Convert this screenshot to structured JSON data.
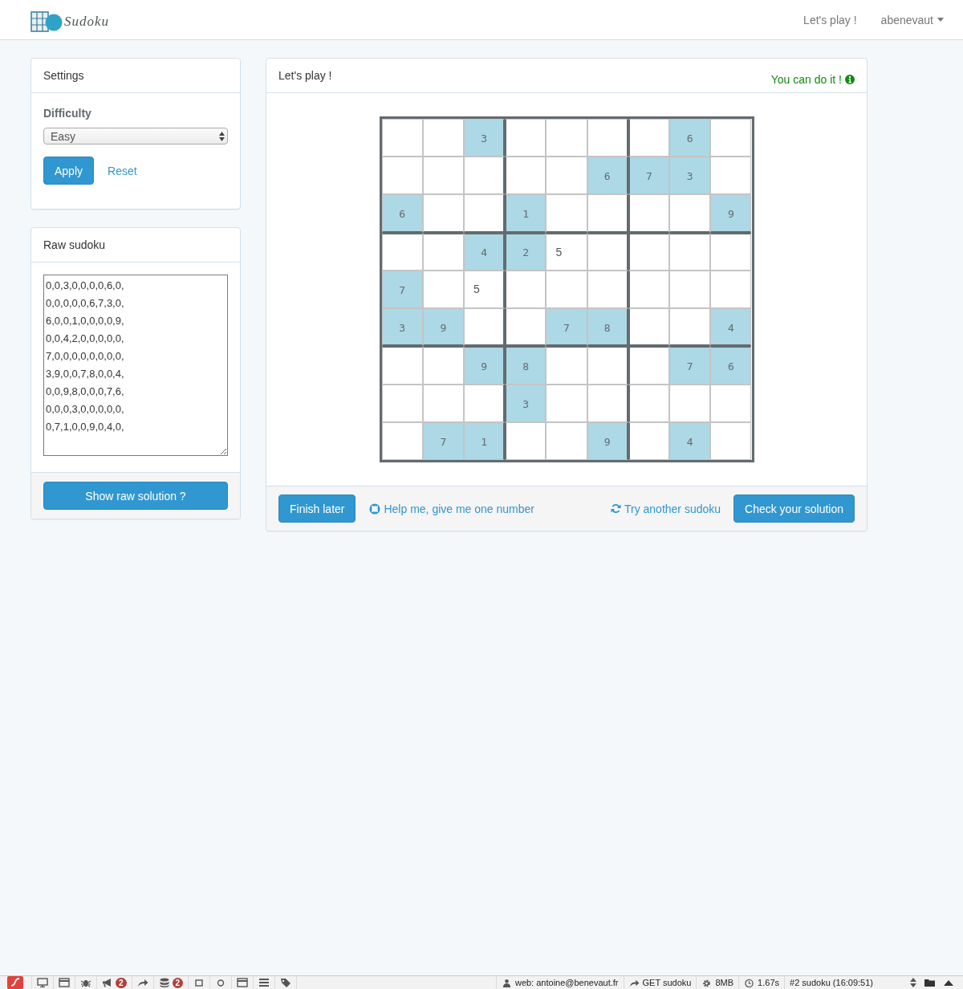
{
  "navbar": {
    "brand": "Sudoku",
    "links": [
      {
        "kind": "link",
        "label": "Let's play !"
      },
      {
        "kind": "dropdown",
        "label": "abenevaut"
      }
    ]
  },
  "settings": {
    "title": "Settings",
    "difficulty": {
      "label": "Difficulty",
      "value": "Easy"
    },
    "apply": "Apply",
    "reset": "Reset"
  },
  "raw_sudoku": {
    "title": "Raw sudoku",
    "value": "0,0,3,0,0,0,0,6,0,\n0,0,0,0,0,6,7,3,0,\n6,0,0,1,0,0,0,0,9,\n0,0,4,2,0,0,0,0,0,\n7,0,0,0,0,0,0,0,0,\n3,9,0,0,7,8,0,0,4,\n0,0,9,8,0,0,0,7,6,\n0,0,0,3,0,0,0,0,0,\n0,7,1,0,0,9,0,4,0,",
    "button": "Show raw solution ?"
  },
  "board": {
    "title": "Let's play !",
    "message": "You can do it !",
    "rows": [
      [
        {
          "kind": "entry"
        },
        {
          "kind": "entry"
        },
        {
          "kind": "given",
          "value": "3"
        },
        {
          "kind": "entry"
        },
        {
          "kind": "entry"
        },
        {
          "kind": "entry"
        },
        {
          "kind": "entry"
        },
        {
          "kind": "given",
          "value": "6"
        },
        {
          "kind": "entry"
        }
      ],
      [
        {
          "kind": "entry"
        },
        {
          "kind": "entry"
        },
        {
          "kind": "entry"
        },
        {
          "kind": "entry"
        },
        {
          "kind": "entry"
        },
        {
          "kind": "given",
          "value": "6"
        },
        {
          "kind": "given",
          "value": "7"
        },
        {
          "kind": "given",
          "value": "3"
        },
        {
          "kind": "entry"
        }
      ],
      [
        {
          "kind": "given",
          "value": "6"
        },
        {
          "kind": "entry"
        },
        {
          "kind": "entry"
        },
        {
          "kind": "given",
          "value": "1"
        },
        {
          "kind": "entry"
        },
        {
          "kind": "entry"
        },
        {
          "kind": "entry"
        },
        {
          "kind": "entry"
        },
        {
          "kind": "given",
          "value": "9"
        }
      ],
      [
        {
          "kind": "entry"
        },
        {
          "kind": "entry"
        },
        {
          "kind": "given",
          "value": "4"
        },
        {
          "kind": "given",
          "value": "2"
        },
        {
          "kind": "entry",
          "value": "5"
        },
        {
          "kind": "entry"
        },
        {
          "kind": "entry"
        },
        {
          "kind": "entry"
        },
        {
          "kind": "entry"
        }
      ],
      [
        {
          "kind": "given",
          "value": "7"
        },
        {
          "kind": "entry"
        },
        {
          "kind": "entry",
          "value": "5"
        },
        {
          "kind": "entry"
        },
        {
          "kind": "entry"
        },
        {
          "kind": "entry"
        },
        {
          "kind": "entry"
        },
        {
          "kind": "entry"
        },
        {
          "kind": "entry"
        }
      ],
      [
        {
          "kind": "given",
          "value": "3"
        },
        {
          "kind": "given",
          "value": "9"
        },
        {
          "kind": "entry"
        },
        {
          "kind": "entry"
        },
        {
          "kind": "given",
          "value": "7"
        },
        {
          "kind": "given",
          "value": "8"
        },
        {
          "kind": "entry"
        },
        {
          "kind": "entry"
        },
        {
          "kind": "given",
          "value": "4"
        }
      ],
      [
        {
          "kind": "entry"
        },
        {
          "kind": "entry"
        },
        {
          "kind": "given",
          "value": "9"
        },
        {
          "kind": "given",
          "value": "8"
        },
        {
          "kind": "entry"
        },
        {
          "kind": "entry"
        },
        {
          "kind": "entry"
        },
        {
          "kind": "given",
          "value": "7"
        },
        {
          "kind": "given",
          "value": "6"
        }
      ],
      [
        {
          "kind": "entry"
        },
        {
          "kind": "entry"
        },
        {
          "kind": "entry"
        },
        {
          "kind": "given",
          "value": "3"
        },
        {
          "kind": "entry"
        },
        {
          "kind": "entry"
        },
        {
          "kind": "entry"
        },
        {
          "kind": "entry"
        },
        {
          "kind": "entry"
        }
      ],
      [
        {
          "kind": "entry"
        },
        {
          "kind": "given",
          "value": "7"
        },
        {
          "kind": "given",
          "value": "1"
        },
        {
          "kind": "entry"
        },
        {
          "kind": "entry"
        },
        {
          "kind": "given",
          "value": "9"
        },
        {
          "kind": "entry"
        },
        {
          "kind": "given",
          "value": "4"
        },
        {
          "kind": "entry"
        }
      ]
    ],
    "footer": {
      "left": [
        {
          "kind": "button",
          "label": "Finish later"
        },
        {
          "kind": "help",
          "label": "Help me, give me one number"
        }
      ],
      "right": [
        {
          "kind": "retry",
          "label": "Try another sudoku"
        },
        {
          "kind": "button",
          "label": "Check your solution"
        }
      ]
    }
  },
  "debug_toolbar": {
    "badges": [
      "2",
      "2"
    ],
    "items": [
      {
        "kind": "user",
        "text": "web: antoine@benevaut.fr"
      },
      {
        "kind": "request",
        "text": "GET sudoku"
      },
      {
        "kind": "memory",
        "text": "8MB"
      },
      {
        "kind": "time",
        "text": "1.67s"
      },
      {
        "kind": "plain",
        "text": "#2 sudoku (16:09:51)"
      }
    ]
  }
}
